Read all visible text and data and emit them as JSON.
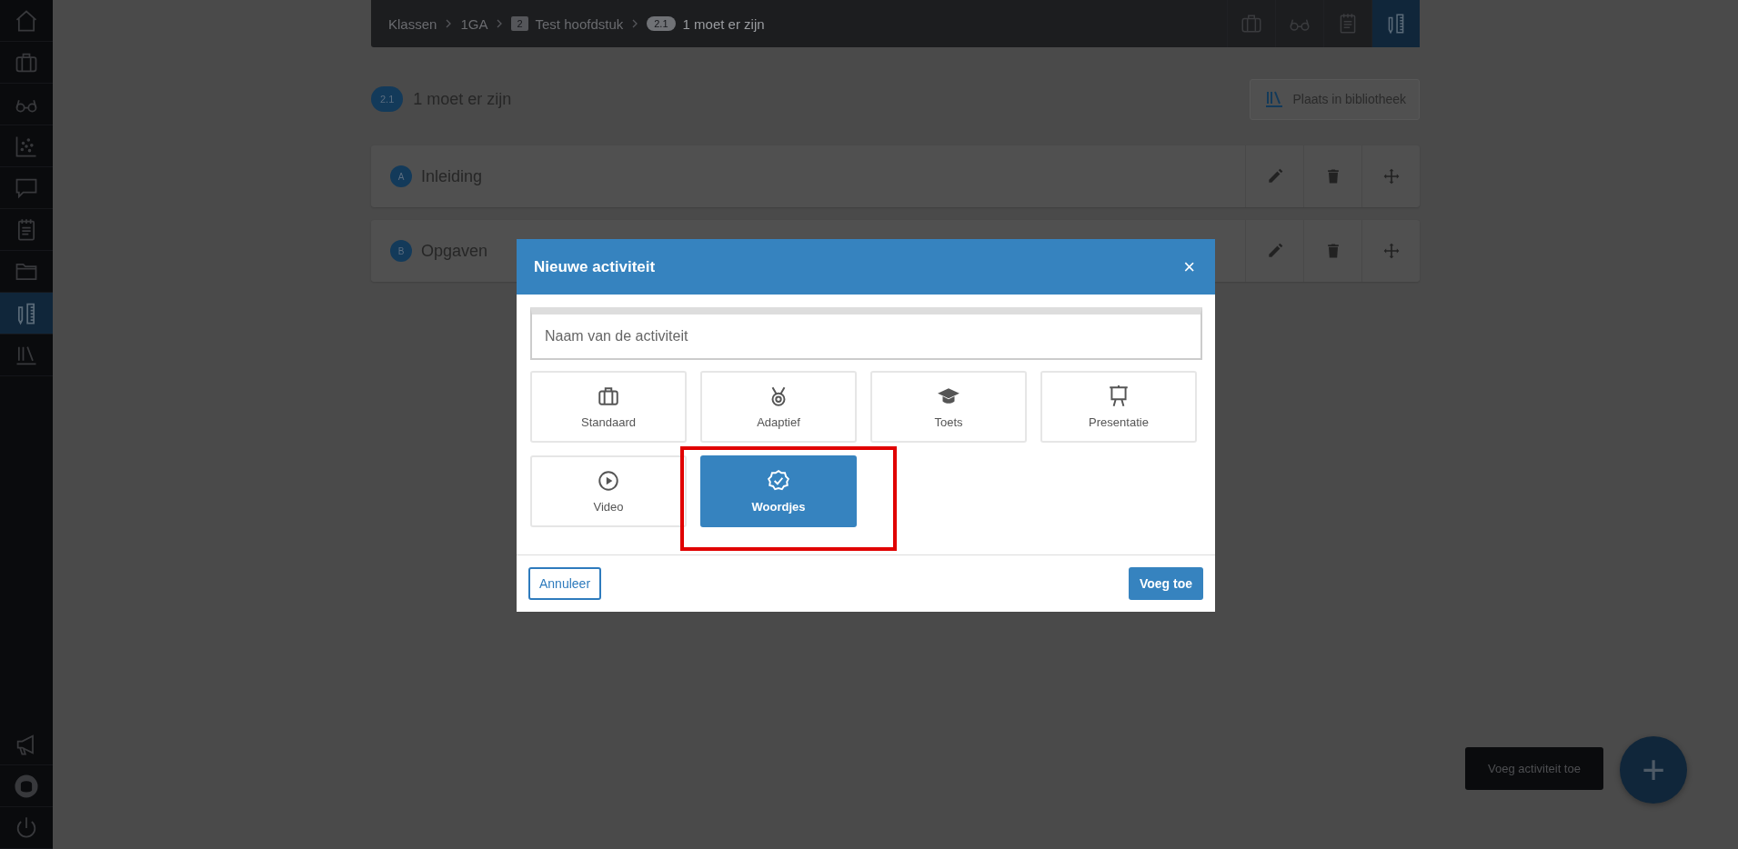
{
  "sidebar": {
    "items": [
      {
        "selected": false
      },
      {
        "selected": false
      },
      {
        "selected": false
      },
      {
        "selected": false
      },
      {
        "selected": false
      },
      {
        "selected": false
      },
      {
        "selected": false
      },
      {
        "selected": true
      },
      {
        "selected": false
      }
    ],
    "bottom_items": [
      {
        "selected": false
      },
      {
        "selected": false
      },
      {
        "selected": false
      }
    ]
  },
  "breadcrumb": [
    {
      "label": "Klassen",
      "current": false
    },
    {
      "label": "1GA",
      "current": false
    },
    {
      "badge": "2",
      "label": "Test hoofdstuk",
      "current": false
    },
    {
      "badge": "2.1",
      "label": "1 moet er zijn",
      "current": true
    }
  ],
  "toolbar": {
    "items": [
      {
        "selected": false
      },
      {
        "selected": false
      },
      {
        "selected": false
      },
      {
        "selected": true
      }
    ]
  },
  "page": {
    "badge": "2.1",
    "title": "1 moet er zijn",
    "library_button": "Plaats in bibliotheek"
  },
  "sections": [
    {
      "badge": "A",
      "title": "Inleiding"
    },
    {
      "badge": "B",
      "title": "Opgaven"
    }
  ],
  "dialog": {
    "title": "Nieuwe activiteit",
    "close": "×",
    "name_field": {
      "placeholder": "Naam van de activiteit"
    },
    "types": [
      {
        "label": "Standaard",
        "selected": false,
        "annotated": false
      },
      {
        "label": "Adaptief",
        "selected": false,
        "annotated": false
      },
      {
        "label": "Toets",
        "selected": false,
        "annotated": false
      },
      {
        "label": "Presentatie",
        "selected": false,
        "annotated": false
      },
      {
        "label": "Video",
        "selected": false,
        "annotated": false
      },
      {
        "label": "Woordjes",
        "selected": true,
        "annotated": true
      }
    ],
    "cancel": "Annuleer",
    "confirm": "Voeg toe"
  },
  "fab": {
    "tooltip": "Voeg activiteit toe",
    "icon": "+"
  }
}
